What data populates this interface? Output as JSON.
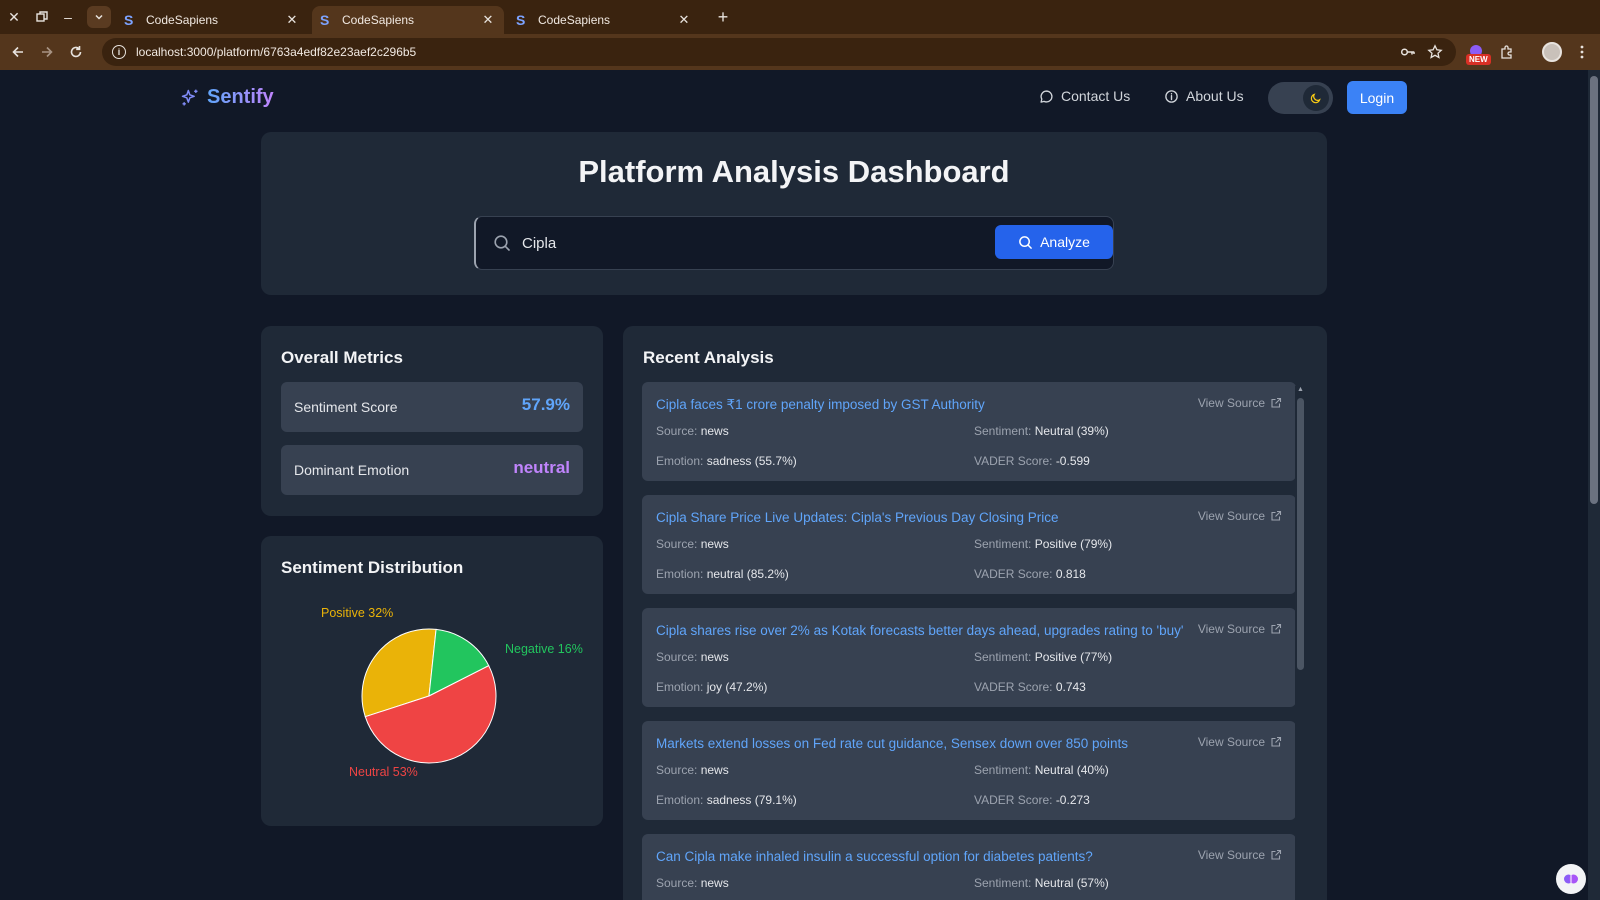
{
  "browser": {
    "tabs": [
      {
        "title": "CodeSapiens",
        "active": false
      },
      {
        "title": "CodeSapiens",
        "active": true
      },
      {
        "title": "CodeSapiens",
        "active": false
      }
    ],
    "url": "localhost:3000/platform/6763a4edf82e23aef2c296b5",
    "new_badge": "NEW"
  },
  "navbar": {
    "brand": "Sentify",
    "contact": "Contact Us",
    "about": "About Us",
    "login": "Login"
  },
  "hero": {
    "title": "Platform Analysis Dashboard",
    "search_value": "Cipla",
    "analyze_label": "Analyze"
  },
  "metrics": {
    "title": "Overall Metrics",
    "sentiment_label": "Sentiment Score",
    "sentiment_value": "57.9%",
    "emotion_label": "Dominant Emotion",
    "emotion_value": "neutral"
  },
  "distribution": {
    "title": "Sentiment Distribution"
  },
  "chart_data": {
    "type": "pie",
    "slices": [
      {
        "label": "Positive 32%",
        "value": 32,
        "color": "#eab308"
      },
      {
        "label": "Negative 16%",
        "value": 16,
        "color": "#22c55e"
      },
      {
        "label": "Neutral 53%",
        "value": 53,
        "color": "#ef4444"
      }
    ]
  },
  "recent": {
    "title": "Recent Analysis",
    "view_source": "View Source",
    "labels": {
      "source": "Source:",
      "sentiment": "Sentiment:",
      "emotion": "Emotion:",
      "vader": "VADER Score:"
    },
    "items": [
      {
        "title": "Cipla faces ₹1 crore penalty imposed by GST Authority",
        "source": "news",
        "sentiment": "Neutral (39%)",
        "emotion": "sadness (55.7%)",
        "vader": "-0.599"
      },
      {
        "title": "Cipla Share Price Live Updates: Cipla's Previous Day Closing Price",
        "source": "news",
        "sentiment": "Positive (79%)",
        "emotion": "neutral (85.2%)",
        "vader": "0.818"
      },
      {
        "title": "Cipla shares rise over 2% as Kotak forecasts better days ahead, upgrades rating to 'buy'",
        "source": "news",
        "sentiment": "Positive (77%)",
        "emotion": "joy (47.2%)",
        "vader": "0.743"
      },
      {
        "title": "Markets extend losses on Fed rate cut guidance, Sensex down over 850 points",
        "source": "news",
        "sentiment": "Neutral (40%)",
        "emotion": "sadness (79.1%)",
        "vader": "-0.273"
      },
      {
        "title": "Can Cipla make inhaled insulin a successful option for diabetes patients?",
        "source": "news",
        "sentiment": "Neutral (57%)",
        "emotion": "",
        "vader": ""
      }
    ]
  },
  "colors": {
    "accent": "#3b82f6",
    "sentiment_value": "#60a5fa",
    "emotion_value": "#c084fc",
    "link": "#60a5fa"
  }
}
